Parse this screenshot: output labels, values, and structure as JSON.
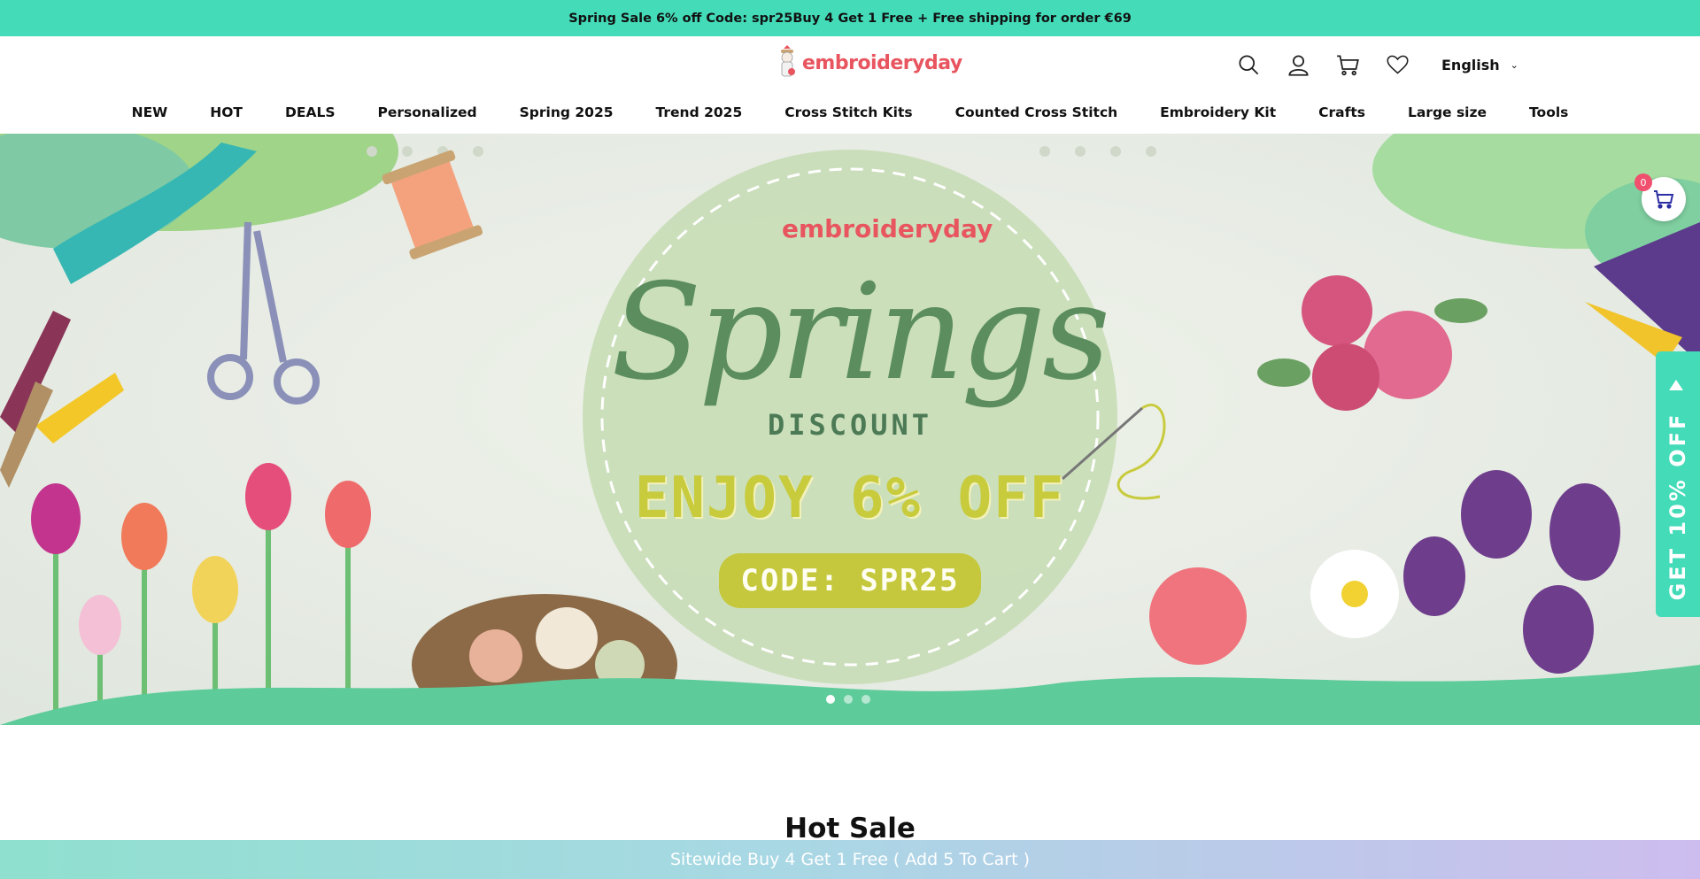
{
  "announcement": {
    "text": "Spring Sale 6% off Code: spr25Buy 4 Get 1 Free + Free shipping for order €69"
  },
  "header": {
    "logo_text": "embroideryday",
    "icons": [
      "search-icon",
      "user-icon",
      "cart-icon",
      "heart-icon"
    ],
    "language": "English"
  },
  "nav": {
    "items": [
      {
        "label": "NEW"
      },
      {
        "label": "HOT"
      },
      {
        "label": "DEALS"
      },
      {
        "label": "Personalized"
      },
      {
        "label": "Spring 2025"
      },
      {
        "label": "Trend 2025"
      },
      {
        "label": "Cross Stitch Kits"
      },
      {
        "label": "Counted Cross Stitch"
      },
      {
        "label": "Embroidery Kit"
      },
      {
        "label": "Crafts"
      },
      {
        "label": "Large size"
      },
      {
        "label": "Tools"
      }
    ]
  },
  "hero": {
    "brand": "embroideryday",
    "script_title": "Springs",
    "subtitle": "DISCOUNT",
    "offer": "ENJOY 6% OFF",
    "code": "CODE: SPR25",
    "slides": 3,
    "active_slide": 1
  },
  "floating_cart": {
    "count": "0"
  },
  "side_tab": {
    "label": "GET 10% OFF"
  },
  "sections": {
    "hot_sale_title": "Hot Sale"
  },
  "bottom_bar": {
    "text": "Sitewide Buy 4 Get 1 Free ( Add 5 To Cart )"
  },
  "colors": {
    "accent": "#43dbb8",
    "brand_red": "#e8555f",
    "badge": "#f0506e"
  }
}
